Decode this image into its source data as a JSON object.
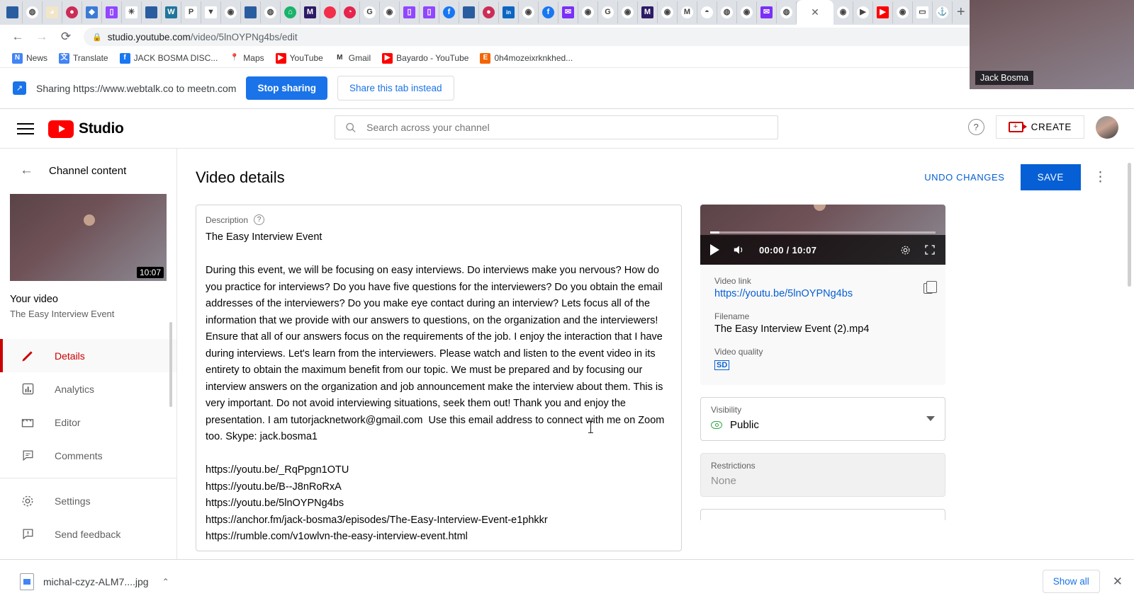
{
  "browser": {
    "tabs": [
      {
        "name": "tab-webtalk",
        "icon": "square-blue",
        "color": "#2a5d9f",
        "glyph": ""
      },
      {
        "name": "tab-webtalk-2",
        "icon": "webtalk-swirl",
        "color": "#ffffff",
        "glyph": "◍"
      },
      {
        "name": "tab-owl",
        "icon": "owl",
        "color": "#f2e6c8",
        "glyph": "◕"
      },
      {
        "name": "tab-youtube-record",
        "icon": "red-dot-circle",
        "color": "#cc2c55",
        "glyph": "●"
      },
      {
        "name": "tab-shield",
        "icon": "shield-blue",
        "color": "#3b7bd4",
        "glyph": "◆"
      },
      {
        "name": "tab-twitch",
        "icon": "twitch",
        "color": "#9146ff",
        "glyph": "▯"
      },
      {
        "name": "tab-sparkle",
        "icon": "sparkle-green",
        "color": "#ffffff",
        "glyph": "✳"
      },
      {
        "name": "tab-blue-square",
        "icon": "square-blue",
        "color": "#2a5d9f",
        "glyph": ""
      },
      {
        "name": "tab-wordpress",
        "icon": "wordpress",
        "color": "#21759b",
        "glyph": "W"
      },
      {
        "name": "tab-paypal",
        "icon": "paypal",
        "color": "#ffffff",
        "glyph": "P"
      },
      {
        "name": "tab-telegram",
        "icon": "telegram-blue",
        "color": "#ffffff",
        "glyph": "▼"
      },
      {
        "name": "tab-chrome",
        "icon": "chrome",
        "color": "#ffffff",
        "glyph": "◉"
      },
      {
        "name": "tab-blue-square-2",
        "icon": "square-blue",
        "color": "#2a5d9f",
        "glyph": ""
      },
      {
        "name": "tab-webtalk-3",
        "icon": "webtalk-swirl",
        "color": "#ffffff",
        "glyph": "◍"
      },
      {
        "name": "tab-green-circle",
        "icon": "green-circle",
        "color": "#19b36b",
        "glyph": "⌂"
      },
      {
        "name": "tab-purple-crown",
        "icon": "purple-badge",
        "color": "#2d1a66",
        "glyph": "M"
      },
      {
        "name": "tab-record-red",
        "icon": "record-red",
        "color": "#f22e48",
        "glyph": ""
      },
      {
        "name": "tab-clock-red",
        "icon": "clock-red",
        "color": "#e5234d",
        "glyph": "◔"
      },
      {
        "name": "tab-google",
        "icon": "google-g",
        "color": "#ffffff",
        "glyph": "G"
      },
      {
        "name": "tab-chrome-2",
        "icon": "chrome",
        "color": "#ffffff",
        "glyph": "◉"
      },
      {
        "name": "tab-twitch-2",
        "icon": "twitch",
        "color": "#9146ff",
        "glyph": "▯"
      },
      {
        "name": "tab-twitch-3",
        "icon": "twitch",
        "color": "#9146ff",
        "glyph": "▯"
      },
      {
        "name": "tab-facebook",
        "icon": "facebook",
        "color": "#1877f2",
        "glyph": "f"
      },
      {
        "name": "tab-blue-square-3",
        "icon": "square-blue",
        "color": "#2a5d9f",
        "glyph": ""
      },
      {
        "name": "tab-youtube-record-2",
        "icon": "red-dot-circle",
        "color": "#cc2c55",
        "glyph": "●"
      },
      {
        "name": "tab-linkedin",
        "icon": "linkedin",
        "color": "#0a66c2",
        "glyph": "in"
      },
      {
        "name": "tab-chrome-3",
        "icon": "chrome",
        "color": "#ffffff",
        "glyph": "◉"
      },
      {
        "name": "tab-facebook-2",
        "icon": "facebook",
        "color": "#1877f2",
        "glyph": "f"
      },
      {
        "name": "tab-mail",
        "icon": "mail-purple",
        "color": "#7b2ff7",
        "glyph": "✉"
      },
      {
        "name": "tab-chrome-4",
        "icon": "chrome",
        "color": "#ffffff",
        "glyph": "◉"
      },
      {
        "name": "tab-google-2",
        "icon": "google-g",
        "color": "#ffffff",
        "glyph": "G"
      },
      {
        "name": "tab-chrome-5",
        "icon": "chrome",
        "color": "#ffffff",
        "glyph": "◉"
      },
      {
        "name": "tab-purple-crown-2",
        "icon": "purple-badge",
        "color": "#2d1a66",
        "glyph": "M"
      },
      {
        "name": "tab-chrome-6",
        "icon": "chrome",
        "color": "#ffffff",
        "glyph": "◉"
      },
      {
        "name": "tab-gmail",
        "icon": "gmail",
        "color": "#ffffff",
        "glyph": "M"
      },
      {
        "name": "tab-reddit",
        "icon": "reddit",
        "color": "#ffffff",
        "glyph": "◓"
      },
      {
        "name": "tab-webtalk-4",
        "icon": "webtalk-swirl",
        "color": "#ffffff",
        "glyph": "◍"
      },
      {
        "name": "tab-chrome-7",
        "icon": "chrome",
        "color": "#ffffff",
        "glyph": "◉"
      },
      {
        "name": "tab-mail-2",
        "icon": "mail-purple",
        "color": "#7b2ff7",
        "glyph": "✉"
      },
      {
        "name": "tab-webtalk-5",
        "icon": "webtalk-swirl",
        "color": "#ffffff",
        "glyph": "◍"
      }
    ],
    "active_tab_close": "✕",
    "tabs_after": [
      {
        "name": "tab-record-circle",
        "icon": "record-red-outline",
        "color": "#ffffff",
        "glyph": "◉"
      },
      {
        "name": "tab-play-green",
        "icon": "play-green",
        "color": "#ffffff",
        "glyph": "▶"
      },
      {
        "name": "tab-youtube",
        "icon": "youtube",
        "color": "#ff0000",
        "glyph": "▶"
      },
      {
        "name": "tab-chrome-8",
        "icon": "chrome",
        "color": "#ffffff",
        "glyph": "◉"
      },
      {
        "name": "tab-blue-frame",
        "icon": "blue-frame",
        "color": "#ffffff",
        "glyph": "▭"
      },
      {
        "name": "tab-anchor",
        "icon": "anchor-black",
        "color": "#ffffff",
        "glyph": "⚓"
      }
    ],
    "new_tab_label": "+",
    "nav": {
      "back": "←",
      "forward": "→",
      "reload": "⟳"
    },
    "url_prefix": "studio.youtube.com",
    "url_suffix": "/video/5lnOYPNg4bs/edit",
    "bookmarks": [
      {
        "label": "News",
        "icon": "google-news-icon",
        "color": "#4285f4",
        "glyph": "N"
      },
      {
        "label": "Translate",
        "icon": "google-translate-icon",
        "color": "#4285f4",
        "glyph": "文"
      },
      {
        "label": "JACK BOSMA DISC...",
        "icon": "facebook-icon",
        "color": "#1877f2",
        "glyph": "f"
      },
      {
        "label": "Maps",
        "icon": "google-maps-icon",
        "color": "#ffffff",
        "glyph": "📍"
      },
      {
        "label": "YouTube",
        "icon": "youtube-icon",
        "color": "#ff0000",
        "glyph": "▶"
      },
      {
        "label": "Gmail",
        "icon": "gmail-icon",
        "color": "#ffffff",
        "glyph": "M"
      },
      {
        "label": "Bayardo - YouTube",
        "icon": "youtube-icon",
        "color": "#ff0000",
        "glyph": "▶"
      },
      {
        "label": "0h4mozeixrknkhed...",
        "icon": "etsy-icon",
        "color": "#f56400",
        "glyph": "E"
      }
    ]
  },
  "sharing_bar": {
    "text": "Sharing https://www.webtalk.co to meetn.com",
    "stop_label": "Stop sharing",
    "share_tab_label": "Share this tab instead",
    "icon": "screen-share-icon"
  },
  "selfview": {
    "name": "Jack Bosma"
  },
  "studio": {
    "logo_word": "Studio",
    "search_placeholder": "Search across your channel",
    "create_label": "CREATE",
    "help_glyph": "?"
  },
  "left_panel": {
    "back_label": "Channel content",
    "duration": "10:07",
    "your_video_label": "Your video",
    "video_title": "The Easy Interview Event",
    "nav": [
      {
        "label": "Details",
        "icon": "pencil-icon",
        "selected": true
      },
      {
        "label": "Analytics",
        "icon": "bar-chart-icon",
        "selected": false
      },
      {
        "label": "Editor",
        "icon": "clapperboard-icon",
        "selected": false
      },
      {
        "label": "Comments",
        "icon": "comment-icon",
        "selected": false
      }
    ],
    "nav_bottom": [
      {
        "label": "Settings",
        "icon": "gear-icon"
      },
      {
        "label": "Send feedback",
        "icon": "feedback-icon"
      }
    ]
  },
  "main": {
    "page_title": "Video details",
    "undo_label": "UNDO CHANGES",
    "save_label": "SAVE",
    "kebab_glyph": "⋮",
    "description": {
      "label": "Description",
      "help_glyph": "?",
      "text": "The Easy Interview Event\n\nDuring this event, we will be focusing on easy interviews. Do interviews make you nervous? How do you practice for interviews? Do you have five questions for the interviewers? Do you obtain the email addresses of the interviewers? Do you make eye contact during an interview? Lets focus all of the information that we provide with our answers to questions, on the organization and the interviewers! Ensure that all of our answers focus on the requirements of the job. I enjoy the interaction that I have during interviews. Let's learn from the interviewers. Please watch and listen to the event video in its entirety to obtain the maximum benefit from our topic. We must be prepared and by focusing our interview answers on the organization and job announcement make the interview about them. This is very important. Do not avoid interviewing situations, seek them out! Thank you and enjoy the presentation. I am tutorjacknetwork@gmail.com  Use this email address to connect with me on Zoom too. Skype: jack.bosma1\n\nhttps://youtu.be/_RqPpgn1OTU\nhttps://youtu.be/B--J8nRoRxA\nhttps://youtu.be/5lnOYPNg4bs\nhttps://anchor.fm/jack-bosma3/episodes/The-Easy-Interview-Event-e1phkkr\nhttps://rumble.com/v1owlvn-the-easy-interview-event.html"
    }
  },
  "right_panel": {
    "player": {
      "time": "00:00 / 10:07",
      "play_icon": "play-icon",
      "volume_icon": "volume-icon",
      "settings_icon": "gear-icon",
      "fullscreen_icon": "fullscreen-icon"
    },
    "video_link_label": "Video link",
    "video_link": "https://youtu.be/5lnOYPNg4bs",
    "filename_label": "Filename",
    "filename": "The Easy Interview Event (2).mp4",
    "quality_label": "Video quality",
    "quality_badge": "SD",
    "visibility_label": "Visibility",
    "visibility_value": "Public",
    "restrictions_label": "Restrictions",
    "restrictions_value": "None"
  },
  "downloads": {
    "file_name": "michal-czyz-ALM7....jpg",
    "chevron": "⌃",
    "show_all_label": "Show all",
    "close_glyph": "✕"
  }
}
